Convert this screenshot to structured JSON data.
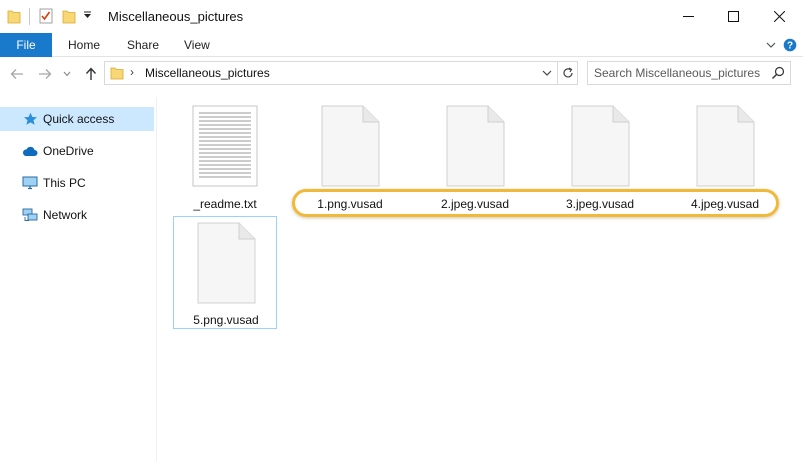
{
  "window": {
    "title": "Miscellaneous_pictures"
  },
  "ribbon": {
    "tabs": [
      {
        "label": "File"
      },
      {
        "label": "Home"
      },
      {
        "label": "Share"
      },
      {
        "label": "View"
      }
    ]
  },
  "address": {
    "path": "Miscellaneous_pictures"
  },
  "search": {
    "placeholder": "Search Miscellaneous_pictures"
  },
  "nav": {
    "items": [
      {
        "label": "Quick access",
        "icon": "star-icon"
      },
      {
        "label": "OneDrive",
        "icon": "cloud-icon"
      },
      {
        "label": "This PC",
        "icon": "computer-icon"
      },
      {
        "label": "Network",
        "icon": "network-icon"
      }
    ]
  },
  "files": [
    {
      "name": "_readme.txt",
      "type": "text"
    },
    {
      "name": "1.png.vusad",
      "type": "blank"
    },
    {
      "name": "2.jpeg.vusad",
      "type": "blank"
    },
    {
      "name": "3.jpeg.vusad",
      "type": "blank"
    },
    {
      "name": "4.jpeg.vusad",
      "type": "blank"
    },
    {
      "name": "5.png.vusad",
      "type": "blank"
    }
  ],
  "colors": {
    "file_tab": "#1979ca",
    "selection": "#cce8ff",
    "highlight": "#f0b93a"
  }
}
